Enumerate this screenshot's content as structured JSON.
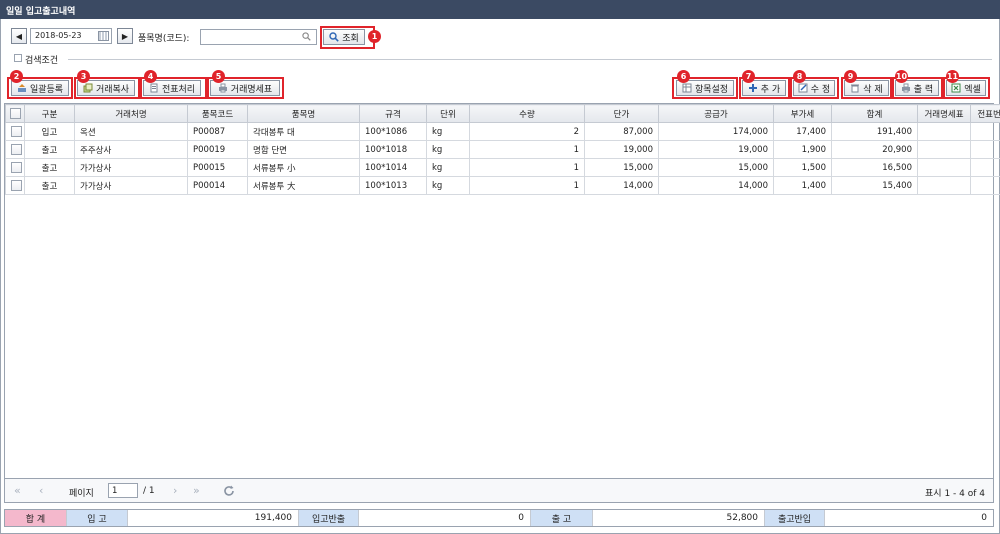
{
  "window": {
    "title": "일일 입고출고내역"
  },
  "search": {
    "prev_icon": "◀",
    "next_icon": "▶",
    "date": "2018-05-23",
    "item_label": "품목명(코드):",
    "item_value": "",
    "search_label": "조회",
    "conditions_label": "검색조건"
  },
  "toolbar": {
    "bulk_register": "일괄등록",
    "copy_transaction": "거래복사",
    "process_slip": "전표처리",
    "transaction_statement": "거래명세표",
    "column_settings": "항목설정",
    "add": "추 가",
    "edit": "수 정",
    "delete": "삭 제",
    "print": "출 력",
    "excel": "엑셀"
  },
  "badges": [
    "1",
    "2",
    "3",
    "4",
    "5",
    "6",
    "7",
    "8",
    "9",
    "10",
    "11"
  ],
  "grid": {
    "columns": [
      "구분",
      "거래처명",
      "품목코드",
      "품목명",
      "규격",
      "단위",
      "수량",
      "단가",
      "공급가",
      "부가세",
      "합계",
      "거래명세표",
      "전표번호"
    ],
    "rows": [
      [
        "입고",
        "옥션",
        "P00087",
        "각대봉투 대",
        "100*1086",
        "kg",
        "2",
        "87,000",
        "174,000",
        "17,400",
        "191,400",
        "",
        ""
      ],
      [
        "출고",
        "주주상사",
        "P00019",
        "명함 단면",
        "100*1018",
        "kg",
        "1",
        "19,000",
        "19,000",
        "1,900",
        "20,900",
        "",
        ""
      ],
      [
        "출고",
        "가가상사",
        "P00015",
        "서류봉투 小",
        "100*1014",
        "kg",
        "1",
        "15,000",
        "15,000",
        "1,500",
        "16,500",
        "",
        ""
      ],
      [
        "출고",
        "가가상사",
        "P00014",
        "서류봉투 大",
        "100*1013",
        "kg",
        "1",
        "14,000",
        "14,000",
        "1,400",
        "15,400",
        "",
        ""
      ]
    ]
  },
  "pager": {
    "page_label": "페이지",
    "page_value": "1",
    "total_pages": "/ 1",
    "display_text": "표시 1 - 4 of 4"
  },
  "summary": {
    "total_label": "합 계",
    "in_label": "입 고",
    "in_value": "191,400",
    "in_return_label": "입고반출",
    "in_return_value": "0",
    "out_label": "출 고",
    "out_value": "52,800",
    "out_return_label": "출고반입",
    "out_return_value": "0"
  },
  "colors": {
    "accent_red": "#e0242b",
    "title_bar": "#3b4a63",
    "summary_pink": "#f4b8cc",
    "summary_blue": "#cfe0f5"
  }
}
